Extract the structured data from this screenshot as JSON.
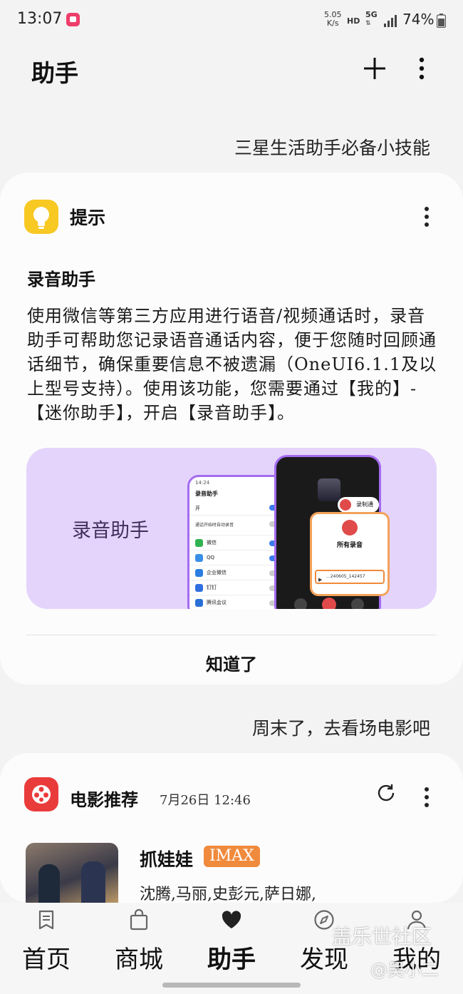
{
  "status_bar": {
    "time": "13:07",
    "net_speed_value": "5.05",
    "net_speed_unit": "K/s",
    "hd": "HD",
    "network": "5G",
    "battery": "74%"
  },
  "header": {
    "title": "助手",
    "add_icon": "plus-icon",
    "more_icon": "more-vertical-icon"
  },
  "sections": {
    "tips_caption": "三星生活助手必备小技能",
    "movie_caption": "周末了，去看场电影吧"
  },
  "tip_card": {
    "title": "提示",
    "icon": "lightbulb-icon",
    "heading": "录音助手",
    "body": "使用微信等第三方应用进行语音/视频通话时，录音助手可帮助您记录语音通话内容，便于您随时回顾通话细节，确保重要信息不被遗漏（OneUI6.1.1及以上型号支持）。使用该功能，您需要通过【我的】-【迷你助手】，开启【录音助手】。",
    "banner_label": "录音助手",
    "banner_phone_left": {
      "title": "录音助手",
      "toggle_main": "开",
      "auto_record": "通话开始时自动录音",
      "apps": [
        "微信",
        "QQ",
        "企业微信",
        "钉钉",
        "腾讯会议"
      ]
    },
    "banner_phone_right": {
      "record_call": "录制通话",
      "all_recordings": "所有录音",
      "file_name": "...240605_142457"
    },
    "confirm_label": "知道了"
  },
  "movie_card": {
    "title": "电影推荐",
    "icon": "film-reel-icon",
    "time": "7月26日  12:46",
    "movie_name": "抓娃娃",
    "badge": "IMAX",
    "cast": "沈腾,马丽,史彭元,萨日娜,"
  },
  "bottom_nav": [
    {
      "label": "首页",
      "icon": "home-doc-icon",
      "active": false
    },
    {
      "label": "商城",
      "icon": "shopping-bag-icon",
      "active": false
    },
    {
      "label": "助手",
      "icon": "heart-icon",
      "active": true
    },
    {
      "label": "发现",
      "icon": "compass-icon",
      "active": false
    },
    {
      "label": "我的",
      "icon": "person-icon",
      "active": false
    }
  ],
  "watermark": {
    "text": "盖乐世社区",
    "author": "@吴小二"
  },
  "colors": {
    "background": "#f3f3f3",
    "card": "#fcfcfc",
    "tip_icon": "#f8c823",
    "movie_icon": "#ea3b3b",
    "banner": "#e4d4fb",
    "banner_phone_border": "#a46bf0",
    "imax_badge": "#f08a3c"
  }
}
